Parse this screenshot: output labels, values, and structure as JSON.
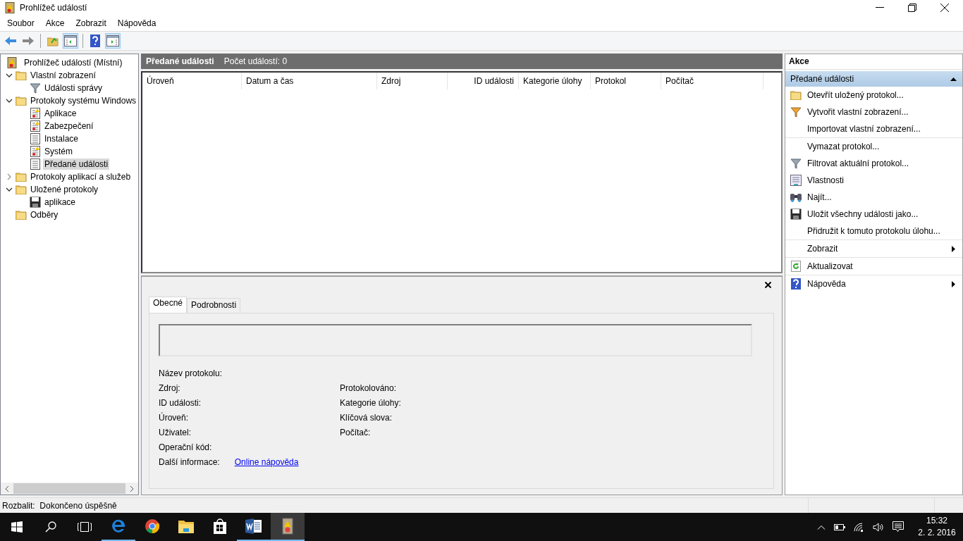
{
  "window": {
    "title": "Prohlížeč událostí"
  },
  "menu": [
    "Soubor",
    "Akce",
    "Zobrazit",
    "Nápověda"
  ],
  "toolbar": [
    {
      "pressed": false
    },
    {
      "pressed": false
    },
    {
      "pressed": false
    },
    {
      "pressed": true
    },
    {
      "pressed": false
    },
    {
      "pressed": true
    }
  ],
  "tree": {
    "root": "Prohlížeč událostí (Místní)",
    "items": [
      {
        "label": "Vlastní zobrazení",
        "kind": "folder",
        "expanded": true,
        "selected": false,
        "children": [
          {
            "label": "Události správy",
            "kind": "filter",
            "selected": false
          }
        ]
      },
      {
        "label": "Protokoly systému Windows",
        "kind": "folder",
        "expanded": true,
        "selected": false,
        "children": [
          {
            "label": "Aplikace",
            "kind": "log-alert",
            "selected": false
          },
          {
            "label": "Zabezpečení",
            "kind": "log-alert",
            "selected": false
          },
          {
            "label": "Instalace",
            "kind": "log",
            "selected": false
          },
          {
            "label": "Systém",
            "kind": "log-alert",
            "selected": false
          },
          {
            "label": "Předané události",
            "kind": "log",
            "selected": true
          }
        ]
      },
      {
        "label": "Protokoly aplikací a služeb",
        "kind": "folder",
        "expanded": false,
        "selected": false
      },
      {
        "label": "Uložené protokoly",
        "kind": "folder",
        "expanded": true,
        "selected": false,
        "children": [
          {
            "label": "aplikace",
            "kind": "disk",
            "selected": false
          }
        ]
      },
      {
        "label": "Odběry",
        "kind": "folder",
        "selected": false
      }
    ]
  },
  "center": {
    "title": "Předané události",
    "count": "Počet událostí: 0",
    "columns": [
      "Úroveň",
      "Datum a čas",
      "Zdroj",
      "ID události",
      "Kategorie úlohy",
      "Protokol",
      "Počítač"
    ],
    "tabs": [
      {
        "label": "Obecné",
        "selected": true
      },
      {
        "label": "Podrobnosti",
        "selected": false
      }
    ],
    "fields_left": [
      "Název protokolu:",
      "Zdroj:",
      "ID události:",
      "Úroveň:",
      "Uživatel:",
      "Operační kód:"
    ],
    "fields_right": [
      "Protokolováno:",
      "Kategorie úlohy:",
      "Klíčová slova:",
      "Počítač:"
    ],
    "more_info": {
      "label": "Další informace:",
      "link": "Online nápověda"
    }
  },
  "actions": {
    "title": "Akce",
    "section": "Předané události",
    "items": [
      {
        "label": "Otevřít uložený protokol...",
        "separator_before": false,
        "submenu": false
      },
      {
        "label": "Vytvořit vlastní zobrazení...",
        "separator_before": false,
        "submenu": false
      },
      {
        "label": "Importovat vlastní zobrazení...",
        "separator_before": false,
        "submenu": false
      },
      {
        "label": "Vymazat protokol...",
        "separator_before": true,
        "submenu": false
      },
      {
        "label": "Filtrovat aktuální protokol...",
        "separator_before": false,
        "submenu": false
      },
      {
        "label": "Vlastnosti",
        "separator_before": false,
        "submenu": false
      },
      {
        "label": "Najít...",
        "separator_before": false,
        "submenu": false
      },
      {
        "label": "Uložit všechny události jako...",
        "separator_before": false,
        "submenu": false
      },
      {
        "label": "Přidružit k tomuto protokolu úlohu...",
        "separator_before": false,
        "submenu": false
      },
      {
        "label": "Zobrazit",
        "separator_before": true,
        "submenu": true
      },
      {
        "label": "Aktualizovat",
        "separator_before": true,
        "submenu": false
      },
      {
        "label": "Nápověda",
        "separator_before": true,
        "submenu": true
      }
    ]
  },
  "status_bar": "Rozbalit:  Dokončeno úspěšně",
  "taskbar": {
    "apps": [
      {
        "running": true,
        "selected": false
      },
      {
        "running": false,
        "selected": false
      },
      {
        "running": false,
        "selected": false
      },
      {
        "running": false,
        "selected": false
      },
      {
        "running": true,
        "selected": false
      },
      {
        "running": true,
        "selected": true
      }
    ],
    "time": "15:32",
    "date": "2. 2. 2016"
  }
}
